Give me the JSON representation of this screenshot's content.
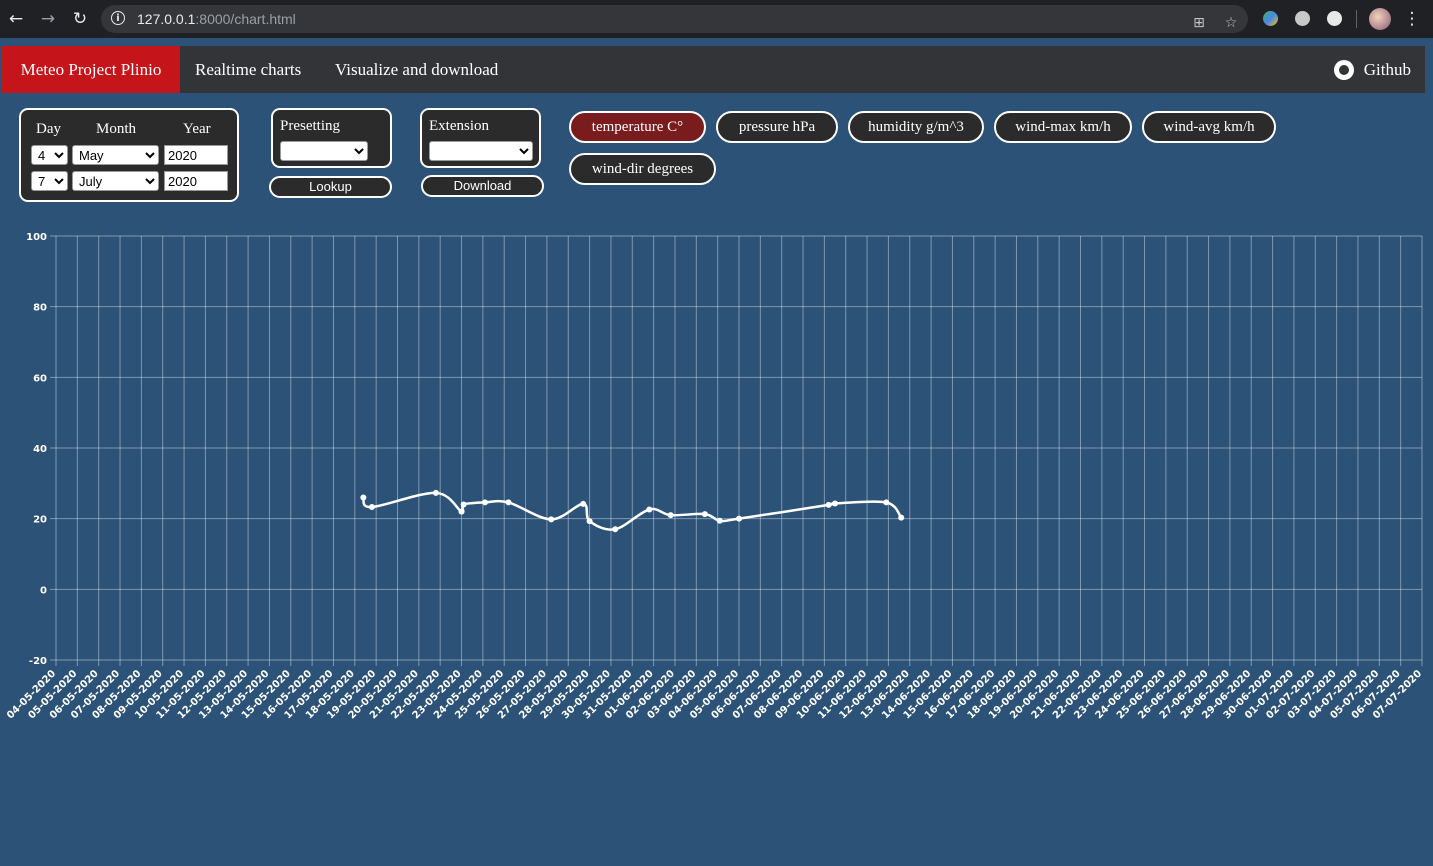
{
  "browser": {
    "url_host": "127.0.0.1",
    "url_rest": ":8000/chart.html",
    "icons": [
      "back-icon",
      "forward-icon",
      "reload-icon",
      "info-icon",
      "translate-icon",
      "star-icon",
      "menu-icon"
    ]
  },
  "nav": {
    "brand": "Meteo Project Plinio",
    "links": [
      "Realtime charts",
      "Visualize and download"
    ],
    "github": "Github"
  },
  "date_panel": {
    "day_label": "Day",
    "month_label": "Month",
    "year_label": "Year",
    "from": {
      "day": "4",
      "month": "May",
      "year": "2020"
    },
    "to": {
      "day": "7",
      "month": "July",
      "year": "2020"
    }
  },
  "presetting": {
    "label": "Presetting",
    "value": "",
    "button": "Lookup"
  },
  "extension": {
    "label": "Extension",
    "value": "",
    "button": "Download"
  },
  "toggles": [
    {
      "label": "temperature C°",
      "active": true
    },
    {
      "label": "pressure hPa",
      "active": false
    },
    {
      "label": "humidity g/m^3",
      "active": false
    },
    {
      "label": "wind-max km/h",
      "active": false
    },
    {
      "label": "wind-avg km/h",
      "active": false
    },
    {
      "label": "wind-dir degrees",
      "active": false
    }
  ],
  "colors": {
    "background": "#2c5278",
    "active_toggle": "#7a1c1e",
    "brand": "#c5151a",
    "line": "#ffffff"
  },
  "chart_data": {
    "type": "line",
    "ylim": [
      -20,
      100
    ],
    "yticks": [
      -20,
      0,
      20,
      40,
      60,
      80,
      100
    ],
    "grid": true,
    "categories": [
      "04-05-2020",
      "05-05-2020",
      "06-05-2020",
      "07-05-2020",
      "08-05-2020",
      "09-05-2020",
      "10-05-2020",
      "11-05-2020",
      "12-05-2020",
      "13-05-2020",
      "14-05-2020",
      "15-05-2020",
      "16-05-2020",
      "17-05-2020",
      "18-05-2020",
      "19-05-2020",
      "20-05-2020",
      "21-05-2020",
      "22-05-2020",
      "23-05-2020",
      "24-05-2020",
      "25-05-2020",
      "26-05-2020",
      "27-05-2020",
      "28-05-2020",
      "29-05-2020",
      "30-05-2020",
      "31-05-2020",
      "01-06-2020",
      "02-06-2020",
      "03-06-2020",
      "04-06-2020",
      "05-06-2020",
      "06-06-2020",
      "07-06-2020",
      "08-06-2020",
      "09-06-2020",
      "10-06-2020",
      "11-06-2020",
      "12-06-2020",
      "13-06-2020",
      "14-06-2020",
      "15-06-2020",
      "16-06-2020",
      "17-06-2020",
      "18-06-2020",
      "19-06-2020",
      "20-06-2020",
      "21-06-2020",
      "22-06-2020",
      "23-06-2020",
      "24-06-2020",
      "25-06-2020",
      "26-06-2020",
      "27-06-2020",
      "28-06-2020",
      "29-06-2020",
      "30-06-2020",
      "01-07-2020",
      "02-07-2020",
      "03-07-2020",
      "04-07-2020",
      "05-07-2020",
      "06-07-2020",
      "07-07-2020"
    ],
    "series": [
      {
        "x": [
          14.4,
          14.8,
          17.8,
          19.0,
          19.1,
          20.1,
          21.2,
          23.2,
          24.7,
          25.0,
          26.2,
          27.8,
          28.8,
          30.4,
          31.1,
          32.0,
          36.2,
          36.5,
          38.9,
          39.6
        ],
        "y": [
          26,
          23.3,
          27.3,
          22,
          24,
          24.6,
          24.6,
          19.8,
          24.2,
          19.3,
          17,
          22.6,
          21,
          21.3,
          19.4,
          20,
          23.9,
          24.3,
          24.6,
          20.3
        ]
      }
    ]
  }
}
